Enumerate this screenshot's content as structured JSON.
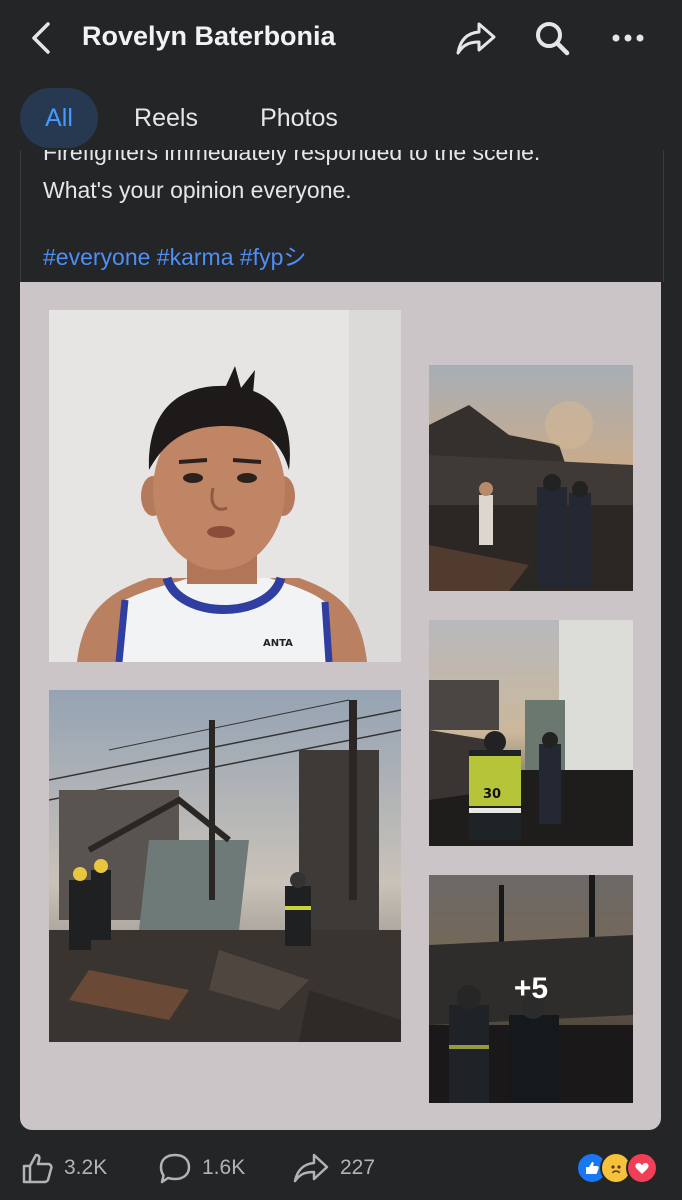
{
  "header": {
    "title": "Rovelyn Baterbonia",
    "back_icon": "chevron-left-icon",
    "share_icon": "share-arrow-icon",
    "search_icon": "search-icon",
    "more_icon": "ellipsis-icon"
  },
  "filters": {
    "tabs": [
      {
        "label": "All",
        "selected": true
      },
      {
        "label": "Reels",
        "selected": false
      },
      {
        "label": "Photos",
        "selected": false
      }
    ]
  },
  "post": {
    "text_cut_line": "Firefighters immediately responded to the scene.",
    "text_question": "What's your opinion everyone.",
    "hashtags": "#everyone #karma #fypシ",
    "photos": [
      {
        "description_icon": "portrait-photo"
      },
      {
        "description_icon": "fire-ruins-photo"
      },
      {
        "description_icon": "firefighters-photo"
      },
      {
        "description_icon": "firefighter-30-photo"
      },
      {
        "description_icon": "smoke-photo"
      }
    ],
    "more_photos_label": "+5",
    "jersey_number": "30"
  },
  "footer": {
    "likes": "3.2K",
    "comments": "1.6K",
    "shares": "227",
    "reactions": [
      "like-reaction-icon",
      "sad-reaction-icon",
      "love-reaction-icon"
    ]
  },
  "colors": {
    "background": "#242526",
    "accent": "#4599ff",
    "hashtag": "#4e8ef7",
    "grid_bg": "#ccc5c7"
  }
}
